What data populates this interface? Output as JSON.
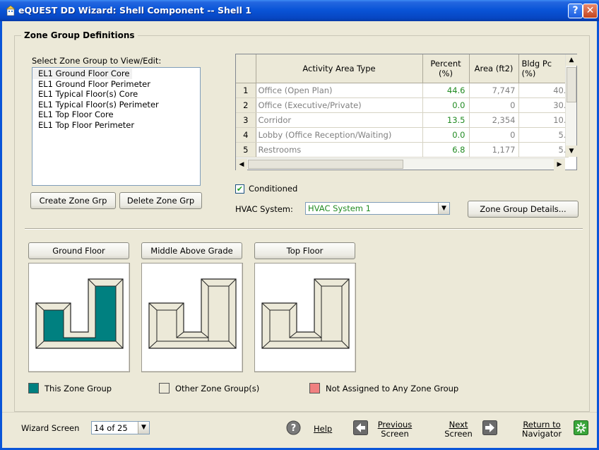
{
  "window": {
    "title": "eQUEST DD Wizard:  Shell Component  --  Shell 1",
    "help_glyph": "?",
    "close_glyph": "✕"
  },
  "group_title": "Zone Group Definitions",
  "zone_list": {
    "label": "Select Zone Group to View/Edit:",
    "items": [
      "EL1 Ground Floor Core",
      "EL1 Ground Floor Perimeter",
      "EL1 Typical Floor(s) Core",
      "EL1 Typical Floor(s) Perimeter",
      "EL1 Top Floor Core",
      "EL1 Top Floor Perimeter"
    ],
    "selected_index": 0
  },
  "buttons": {
    "create": "Create Zone Grp",
    "delete": "Delete Zone Grp",
    "details": "Zone Group Details..."
  },
  "activity_grid": {
    "headers": {
      "type": "Activity Area Type",
      "percent": "Percent (%)",
      "area": "Area (ft2)",
      "bldg": "Bldg Pc (%)"
    },
    "rows": [
      {
        "num": "1",
        "type": "Office (Open Plan)",
        "percent": "44.6",
        "area": "7,747",
        "bldg": "40."
      },
      {
        "num": "2",
        "type": "Office (Executive/Private)",
        "percent": "0.0",
        "area": "0",
        "bldg": "30."
      },
      {
        "num": "3",
        "type": "Corridor",
        "percent": "13.5",
        "area": "2,354",
        "bldg": "10."
      },
      {
        "num": "4",
        "type": "Lobby (Office Reception/Waiting)",
        "percent": "0.0",
        "area": "0",
        "bldg": "5."
      },
      {
        "num": "5",
        "type": "Restrooms",
        "percent": "6.8",
        "area": "1,177",
        "bldg": "5."
      }
    ]
  },
  "conditioned": {
    "label": "Conditioned",
    "checked": true,
    "mark": "✔"
  },
  "hvac": {
    "label": "HVAC System:",
    "value": "HVAC System 1"
  },
  "floors": {
    "ground": "Ground Floor",
    "middle": "Middle Above Grade",
    "top": "Top Floor"
  },
  "legend": {
    "this_group": "This Zone Group",
    "other_groups": "Other Zone Group(s)",
    "not_assigned": "Not Assigned to Any Zone Group"
  },
  "colors": {
    "this_group": "#008080",
    "other_groups": "#ece9d8",
    "not_assigned": "#f08080",
    "value_green": "#228b22"
  },
  "footer": {
    "wizard_label": "Wizard Screen",
    "wizard_value": "14 of 25",
    "help": "Help",
    "previous_1": "Previous",
    "previous_2": "Screen",
    "next_1": "Next",
    "next_2": "Screen",
    "return_1": "Return to",
    "return_2": "Navigator"
  }
}
